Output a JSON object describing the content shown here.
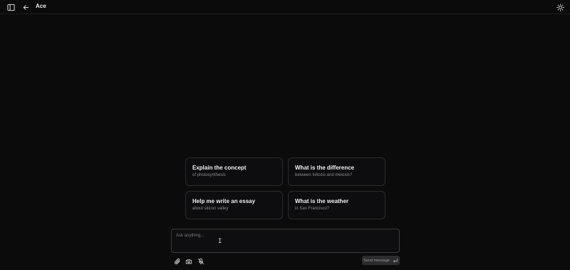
{
  "header": {
    "title": "Ace",
    "icons": {
      "sidebar": "sidebar-toggle-icon",
      "back": "arrow-left-icon",
      "theme": "sun-icon"
    }
  },
  "suggestions": [
    {
      "title": "Explain the concept",
      "subtitle": "of photosynthesis"
    },
    {
      "title": "What is the difference",
      "subtitle": "between mitosis and meiosis?"
    },
    {
      "title": "Help me write an essay",
      "subtitle": "about silicon valley"
    },
    {
      "title": "What is the weather",
      "subtitle": "in San Francisco?"
    }
  ],
  "composer": {
    "placeholder": "Ask anything...",
    "value": "",
    "send_label": "Send message",
    "tools": [
      "paperclip-icon",
      "camera-icon",
      "mic-off-icon"
    ]
  },
  "colors": {
    "background": "#0b0b0c",
    "card_border": "#2b2b2e",
    "send_bg": "#2c2c2f"
  }
}
